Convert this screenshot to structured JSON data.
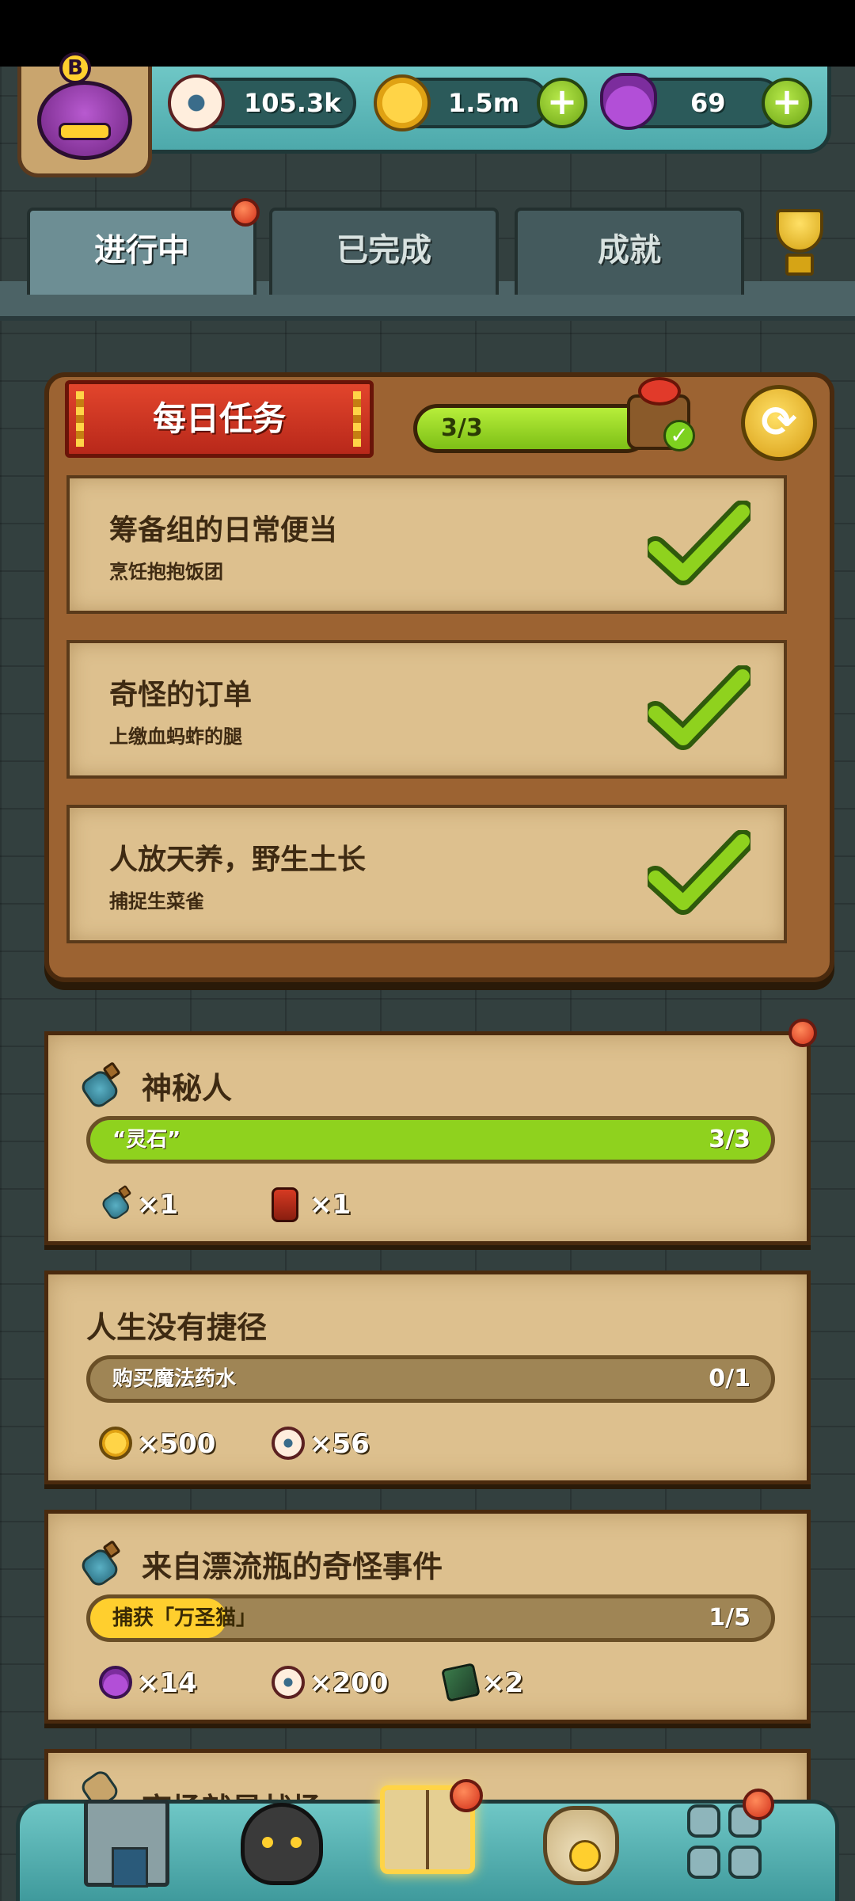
{
  "resources": {
    "eyes": "105.3k",
    "coins": "1.5m",
    "potions": "69",
    "avatar_badge": "B"
  },
  "tabs": [
    {
      "label": "进行中",
      "active": true,
      "has_dot": true
    },
    {
      "label": "已完成",
      "active": false,
      "has_dot": false
    },
    {
      "label": "成就",
      "active": false,
      "has_dot": false
    }
  ],
  "daily": {
    "title": "每日任务",
    "progress_text": "3/3",
    "progress_fraction": 1.0,
    "quests": [
      {
        "title": "筹备组的日常便当",
        "subtitle": "烹饪抱抱饭团",
        "completed": true
      },
      {
        "title": "奇怪的订单",
        "subtitle": "上缴血蚂蚱的腿",
        "completed": true
      },
      {
        "title": "人放天养，野生土长",
        "subtitle": "捕捉生菜雀",
        "completed": true
      }
    ]
  },
  "missions": [
    {
      "title": "神秘人",
      "has_icon": true,
      "has_dot": true,
      "bar_label": "“灵石”",
      "bar_count": "3/3",
      "bar_fraction": 1.0,
      "bar_color": "#8fd21e",
      "rewards": [
        {
          "icon": "bottle-icon",
          "text": "×1"
        },
        {
          "icon": "lantern-icon",
          "text": "×1"
        }
      ]
    },
    {
      "title": "人生没有捷径",
      "has_icon": false,
      "has_dot": false,
      "bar_label": "购买魔法药水",
      "bar_count": "0/1",
      "bar_fraction": 0.0,
      "bar_color": "#ffcf2e",
      "rewards": [
        {
          "icon": "coin-icon",
          "text": "×500"
        },
        {
          "icon": "eye-icon",
          "text": "×56"
        }
      ]
    },
    {
      "title": "来自漂流瓶的奇怪事件",
      "has_icon": true,
      "has_dot": false,
      "bar_label": "捕获「万圣猫」",
      "bar_count": "1/5",
      "bar_fraction": 0.2,
      "bar_color": "#ffcf2e",
      "rewards": [
        {
          "icon": "potion-icon",
          "text": "×14"
        },
        {
          "icon": "eye-icon",
          "text": "×200"
        },
        {
          "icon": "card-icon",
          "text": "×2"
        }
      ]
    },
    {
      "title": "商场就是战场",
      "has_icon": true,
      "has_dot": false
    }
  ],
  "colors": {
    "accent_green": "#8fd21e",
    "accent_yellow": "#ffcf2e",
    "parchment": "#ddc08e",
    "wood": "#9c6332",
    "teal": "#5eb8b8"
  },
  "bottom_nav": [
    {
      "name": "shop",
      "active": false,
      "has_dot": false
    },
    {
      "name": "monster",
      "active": false,
      "has_dot": false
    },
    {
      "name": "quest-book",
      "active": true,
      "has_dot": true
    },
    {
      "name": "bag",
      "active": false,
      "has_dot": false
    },
    {
      "name": "menu",
      "active": false,
      "has_dot": true
    }
  ]
}
